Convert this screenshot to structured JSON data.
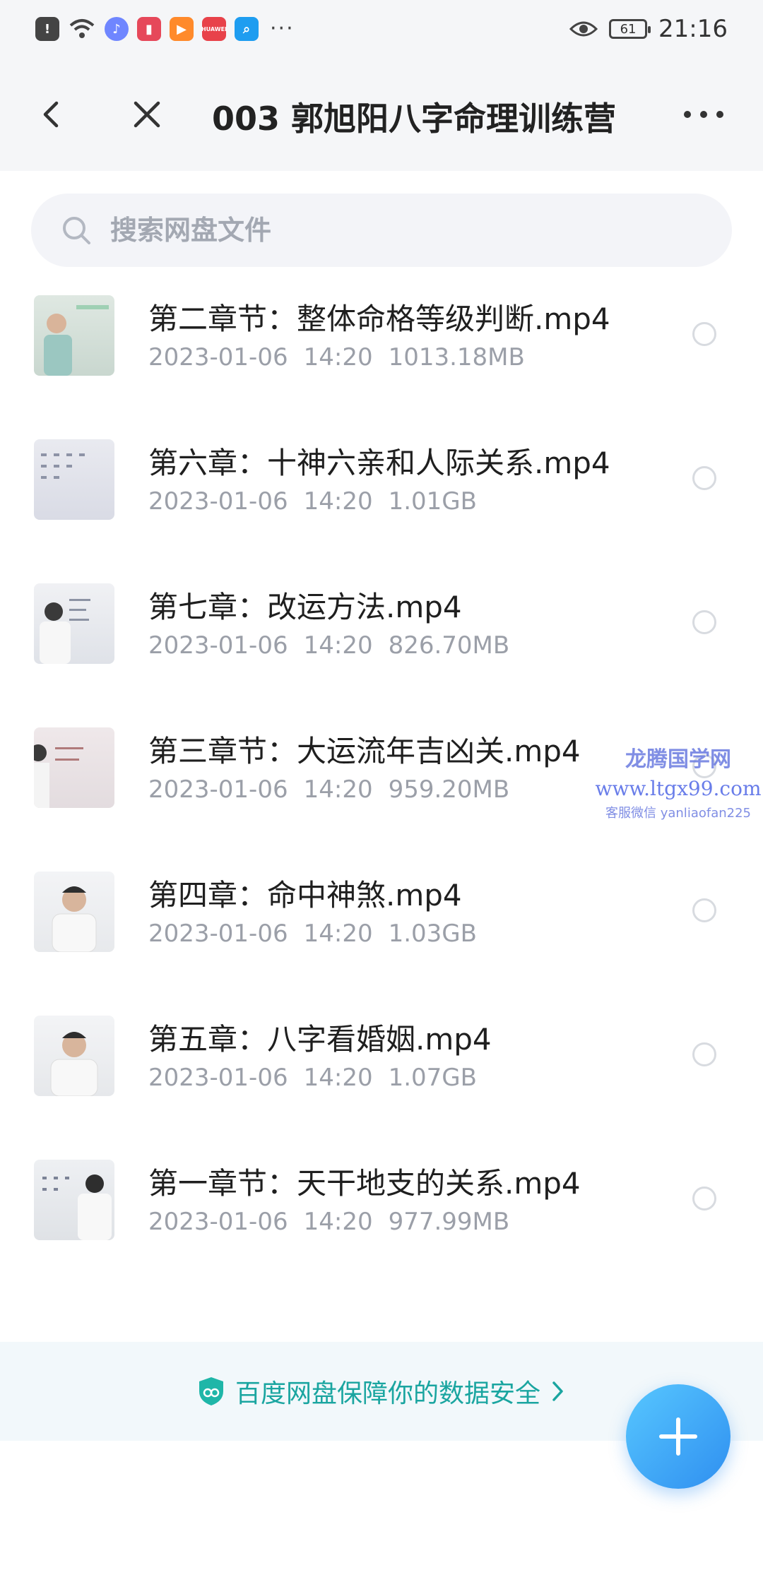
{
  "status_bar": {
    "time": "21:16",
    "battery": "61",
    "icons": [
      "alert-icon",
      "wifi-icon",
      "music-icon",
      "book-icon",
      "video-icon",
      "huawei-icon",
      "search-app-icon"
    ],
    "more": "···",
    "huawei_label": "HUAWEI"
  },
  "header": {
    "title": "003 郭旭阳八字命理训练营"
  },
  "search": {
    "placeholder": "搜索网盘文件"
  },
  "files": [
    {
      "name": "第二章节：整体命格等级判断.mp4",
      "date": "2023-01-06",
      "time": "14:20",
      "size": "1013.18MB"
    },
    {
      "name": "第六章：十神六亲和人际关系.mp4",
      "date": "2023-01-06",
      "time": "14:20",
      "size": "1.01GB"
    },
    {
      "name": "第七章：改运方法.mp4",
      "date": "2023-01-06",
      "time": "14:20",
      "size": "826.70MB"
    },
    {
      "name": "第三章节：大运流年吉凶关.mp4",
      "date": "2023-01-06",
      "time": "14:20",
      "size": "959.20MB"
    },
    {
      "name": "第四章：命中神煞.mp4",
      "date": "2023-01-06",
      "time": "14:20",
      "size": "1.03GB"
    },
    {
      "name": "第五章：八字看婚姻.mp4",
      "date": "2023-01-06",
      "time": "14:20",
      "size": "1.07GB"
    },
    {
      "name": "第一章节：天干地支的关系.mp4",
      "date": "2023-01-06",
      "time": "14:20",
      "size": "977.99MB"
    }
  ],
  "watermark": {
    "line1": "龙腾国学网",
    "line2": "www.ltgx99.com",
    "line3": "客服微信 yanliaofan225"
  },
  "footer": {
    "text": "百度网盘保障你的数据安全"
  },
  "colors": {
    "accent": "#2f8ff0",
    "footer_text": "#1aa5a0",
    "header_bg": "#f5f6f8"
  }
}
